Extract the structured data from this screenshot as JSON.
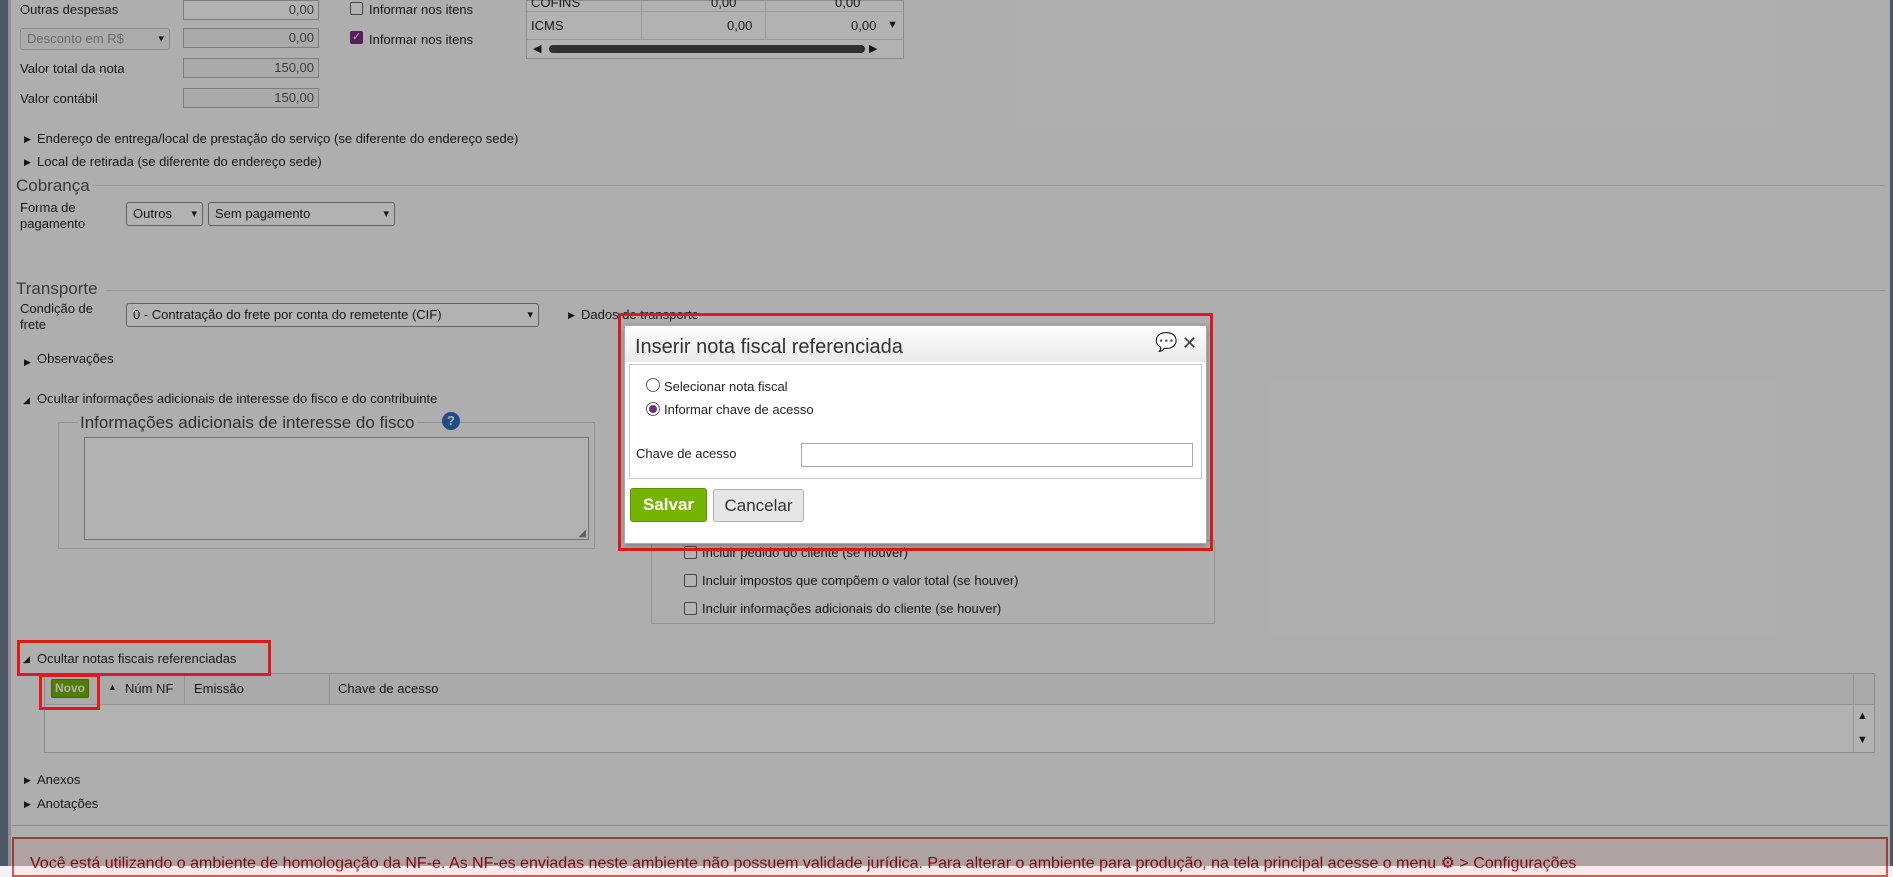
{
  "top": {
    "outras_despesas_label": "Outras despesas",
    "outras_despesas_value": "0,00",
    "desconto_select": "Desconto em R$",
    "desconto_value": "0,00",
    "valor_total_label": "Valor total da nota",
    "valor_total_value": "150,00",
    "valor_contabil_label": "Valor contábil",
    "valor_contabil_value": "150,00",
    "informar_itens_1": "Informar nos itens",
    "informar_itens_2": "Informar nos itens",
    "tax_row_partial": "COFINS",
    "tax_row_partial_v1": "0,00",
    "tax_row_partial_v2": "0,00",
    "tax_row_label": "ICMS",
    "tax_row_v1": "0,00",
    "tax_row_v2": "0,00"
  },
  "sections": {
    "endereco_entrega": "Endereço de entrega/local de prestação do serviço (se diferente do endereço sede)",
    "local_retirada": "Local de retirada (se diferente do endereço sede)",
    "cobranca_title": "Cobrança",
    "forma_pagamento_label": "Forma de pagamento",
    "forma_pagamento_select": "Outros",
    "pagamento_select": "Sem pagamento",
    "transporte_title": "Transporte",
    "condicao_frete_label": "Condição de frete",
    "condicao_frete_select": "0 - Contratação do frete por conta do remetente (CIF)",
    "dados_transporte": "Dados de transporte",
    "observacoes": "Observações",
    "ocultar_info_adicionais": "Ocultar informações adicionais de interesse do fisco e do contribuinte",
    "info_fisco_title": "Informações adicionais de interesse do fisco",
    "incluir_pedido": "Incluir pedido do cliente (se houver)",
    "incluir_impostos": "Incluir impostos que compõem o valor total (se houver)",
    "incluir_info_cliente": "Incluir informações adicionais do cliente (se houver)",
    "ocultar_notas": "Ocultar notas fiscais referenciadas",
    "novo_button": "Novo",
    "col_num_nf": "Núm NF",
    "col_emissao": "Emissão",
    "col_chave": "Chave de acesso",
    "anexos": "Anexos",
    "anotacoes": "Anotações"
  },
  "banner": {
    "text": "Você está utilizando o ambiente de homologação da NF-e. As NF-es enviadas neste ambiente não possuem validade jurídica. Para alterar o ambiente para produção, na tela principal acesse o menu ⚙ > Configurações"
  },
  "dialog": {
    "title": "Inserir nota fiscal referenciada",
    "option_selecionar": "Selecionar nota fiscal",
    "option_informar": "Informar chave de acesso",
    "chave_label": "Chave de acesso",
    "chave_value": "",
    "save_label": "Salvar",
    "cancel_label": "Cancelar"
  },
  "colors": {
    "accent_green": "#74b400",
    "highlight_red": "#e0191f",
    "radio_purple": "#7a2a84"
  }
}
